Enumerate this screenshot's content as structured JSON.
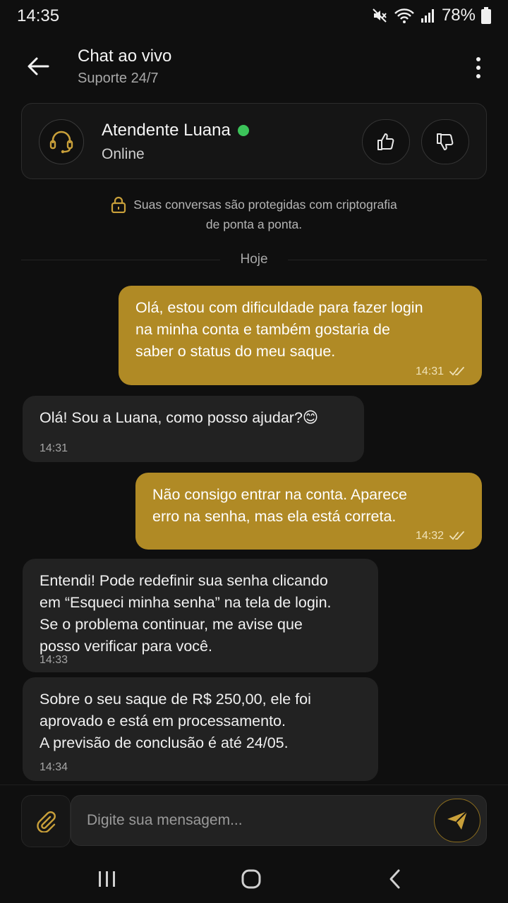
{
  "status_bar": {
    "time": "14:35",
    "battery": "78%"
  },
  "header": {
    "title": "Chat ao vivo",
    "subtitle": "Suporte 24/7"
  },
  "agent": {
    "name": "Atendente Luana",
    "status": "Online",
    "status_color": "#3cc45a"
  },
  "notice": {
    "line1": "Suas conversas são protegidas com criptografia",
    "line2": "de ponta a ponta."
  },
  "date_divider": "Hoje",
  "messages": [
    {
      "direction": "out",
      "text": "Olá, estou com dificuldade para fazer login\nna minha conta e também gostaria de\nsaber o status do meu saque.",
      "time": "14:31"
    },
    {
      "direction": "in",
      "text": "Olá! Sou a Luana, como posso ajudar?😊",
      "time": "14:31"
    },
    {
      "direction": "out",
      "text": "Não consigo entrar na conta. Aparece\nerro na senha, mas ela está correta.",
      "time": "14:32"
    },
    {
      "direction": "in",
      "text": "Entendi! Pode redefinir sua senha clicando\nem “Esqueci minha senha” na tela de login.\nSe o problema continuar, me avise que\nposso verificar para você.",
      "time": "14:33"
    },
    {
      "direction": "in",
      "text": "Sobre o seu saque de R$ 250,00, ele foi\naprovado e está em processamento.\nA previsão de conclusão é até 24/05.",
      "time": "14:34"
    }
  ],
  "input": {
    "placeholder": "Digite sua mensagem..."
  },
  "colors": {
    "accent": "#b08a25",
    "background": "#0f0f0f",
    "incoming_bubble": "#222222"
  }
}
